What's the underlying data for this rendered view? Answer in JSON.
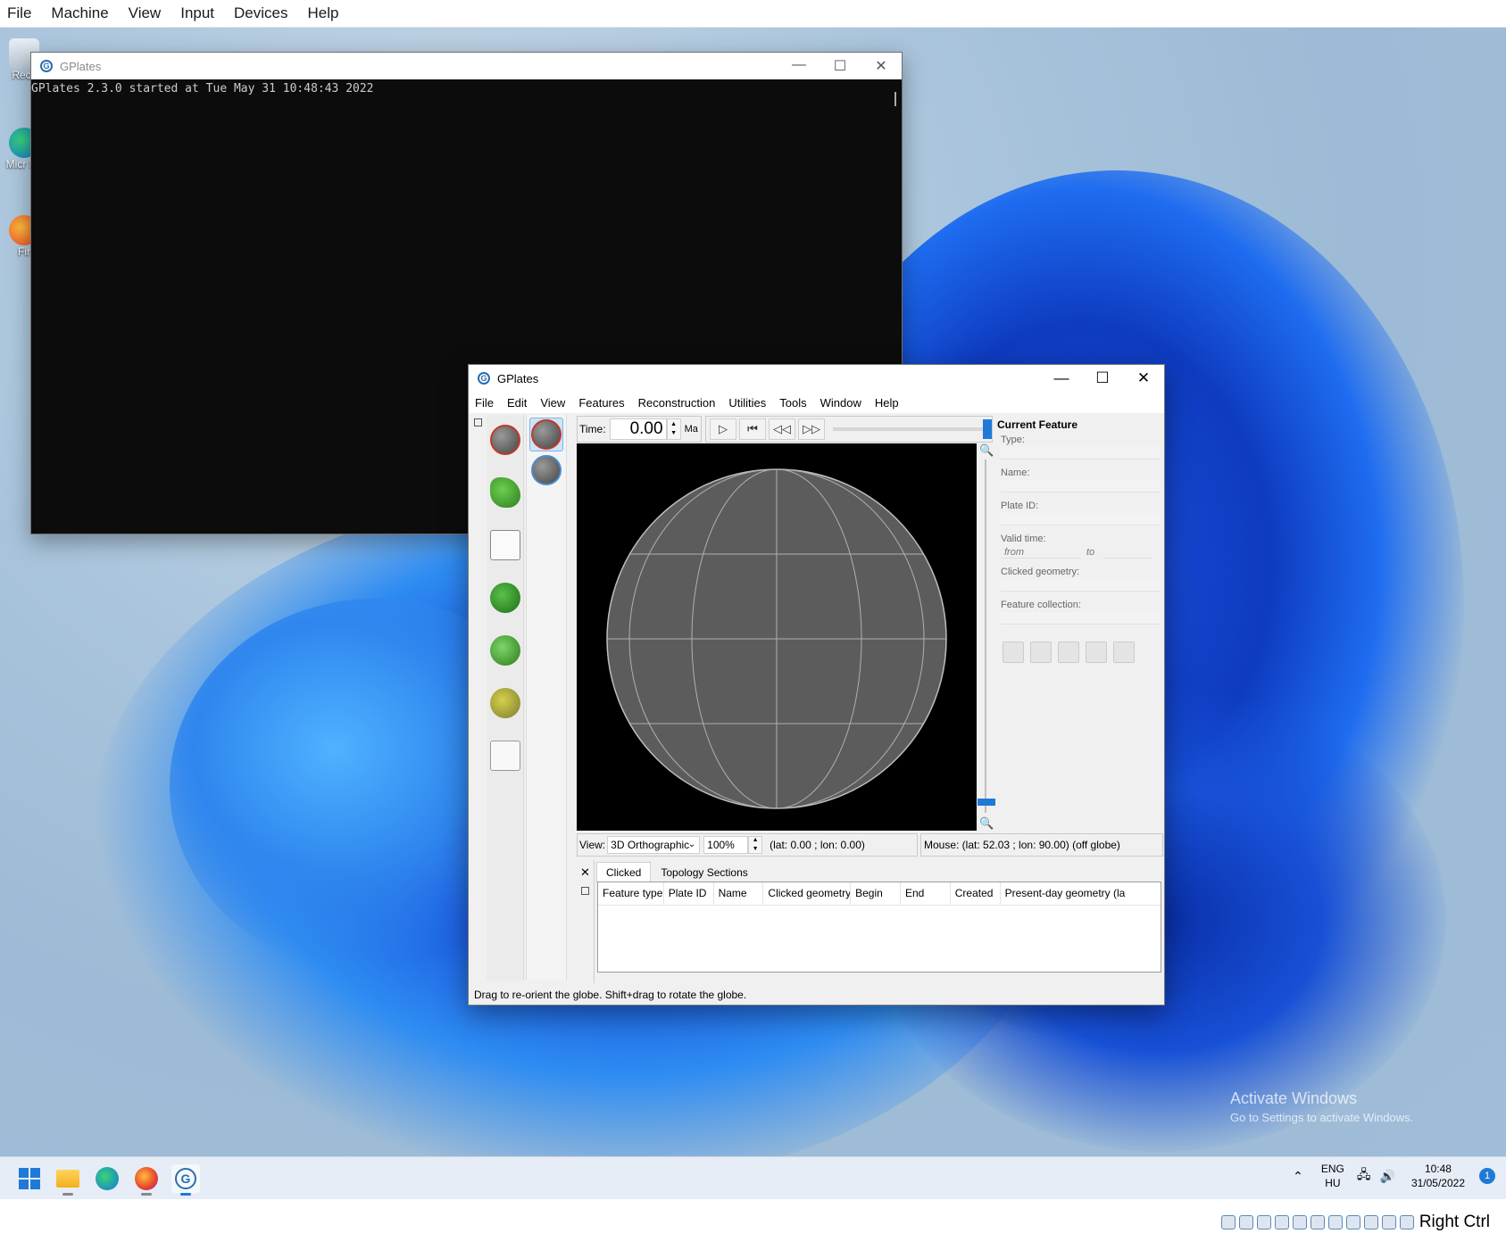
{
  "vbox_menu": [
    "File",
    "Machine",
    "View",
    "Input",
    "Devices",
    "Help"
  ],
  "desktop_icons": [
    "Recy",
    "Micr Ed",
    "Fir"
  ],
  "console": {
    "title": "GPlates",
    "text": "GPlates 2.3.0 started at Tue May 31 10:48:43 2022"
  },
  "gplates": {
    "title": "GPlates",
    "menu": [
      "File",
      "Edit",
      "View",
      "Features",
      "Reconstruction",
      "Utilities",
      "Tools",
      "Window",
      "Help"
    ],
    "time_label": "Time:",
    "time_value": "0.00",
    "time_unit": "Ma",
    "view_label": "View:",
    "projection": "3D Orthographic",
    "zoom": "100%",
    "camera": "(lat: 0.00 ; lon: 0.00)",
    "mouse": "Mouse: (lat: 52.03 ; lon: 90.00) (off globe)",
    "current_feature": {
      "title": "Current Feature",
      "type_label": "Type:",
      "name_label": "Name:",
      "plate_id_label": "Plate ID:",
      "valid_time_label": "Valid time:",
      "from_label": "from",
      "to_label": "to",
      "clicked_geometry_label": "Clicked geometry:",
      "feature_collection_label": "Feature collection:"
    },
    "tabs": [
      "Clicked",
      "Topology Sections"
    ],
    "columns": [
      "Feature type",
      "Plate ID",
      "Name",
      "Clicked geometry",
      "Begin",
      "End",
      "Created",
      "Present-day geometry (la"
    ],
    "status": "Drag to re-orient the globe. Shift+drag to rotate the globe."
  },
  "watermark": {
    "line1": "Activate Windows",
    "line2": "Go to Settings to activate Windows."
  },
  "tray": {
    "lang1": "ENG",
    "lang2": "HU",
    "time": "10:48",
    "date": "31/05/2022",
    "notifications": "1"
  },
  "host_key": "Right Ctrl",
  "colors": {
    "accent": "#1f7ad6",
    "console_bg": "#0c0c0c",
    "globe": "#5c5c5c"
  }
}
